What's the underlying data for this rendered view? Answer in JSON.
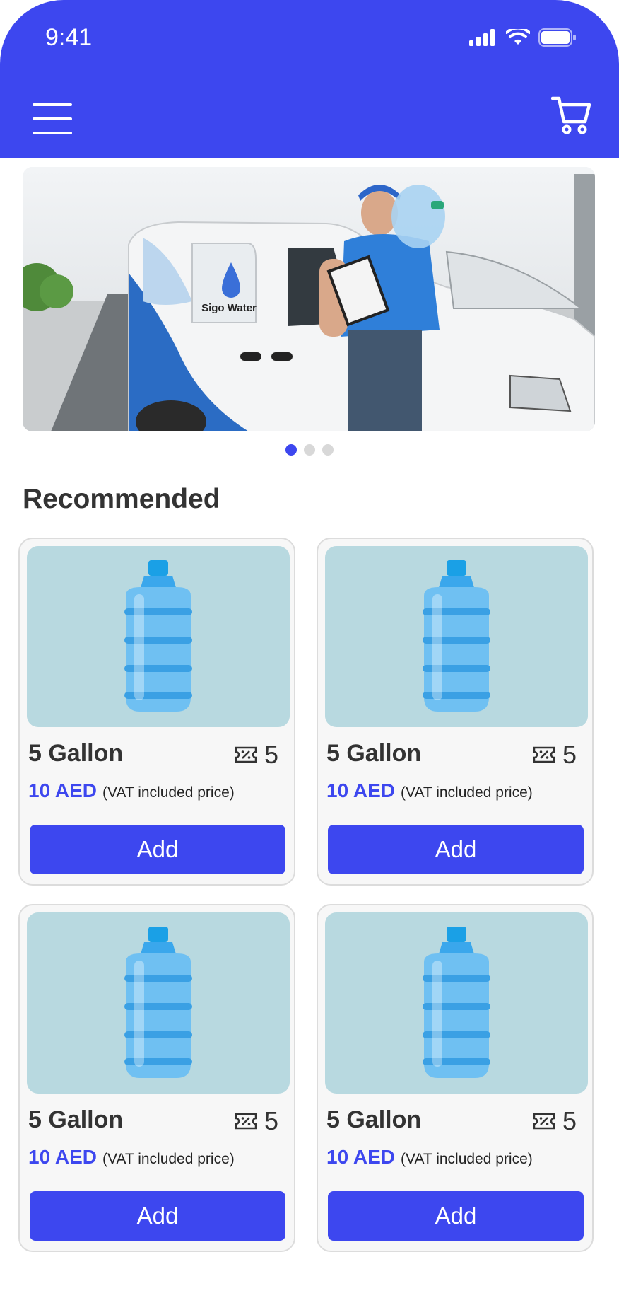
{
  "status_bar": {
    "time": "9:41"
  },
  "banner": {
    "van_brand": "Sigo Water",
    "dots_count": 3,
    "active_index": 0
  },
  "section": {
    "title": "Recommended"
  },
  "products": [
    {
      "name": "5 Gallon",
      "quantity": "5",
      "price": "10 AED",
      "vat_note": "(VAT included price)",
      "button": "Add"
    },
    {
      "name": "5 Gallon",
      "quantity": "5",
      "price": "10 AED",
      "vat_note": "(VAT included price)",
      "button": "Add"
    },
    {
      "name": "5 Gallon",
      "quantity": "5",
      "price": "10 AED",
      "vat_note": "(VAT included price)",
      "button": "Add"
    },
    {
      "name": "5 Gallon",
      "quantity": "5",
      "price": "10 AED",
      "vat_note": "(VAT included price)",
      "button": "Add"
    }
  ],
  "colors": {
    "primary": "#3d47ef",
    "card_bg": "#f7f7f7",
    "image_bg": "#b8d9e0"
  },
  "icons": {
    "menu": "hamburger-icon",
    "cart": "cart-icon",
    "quantity": "ticket-icon"
  }
}
